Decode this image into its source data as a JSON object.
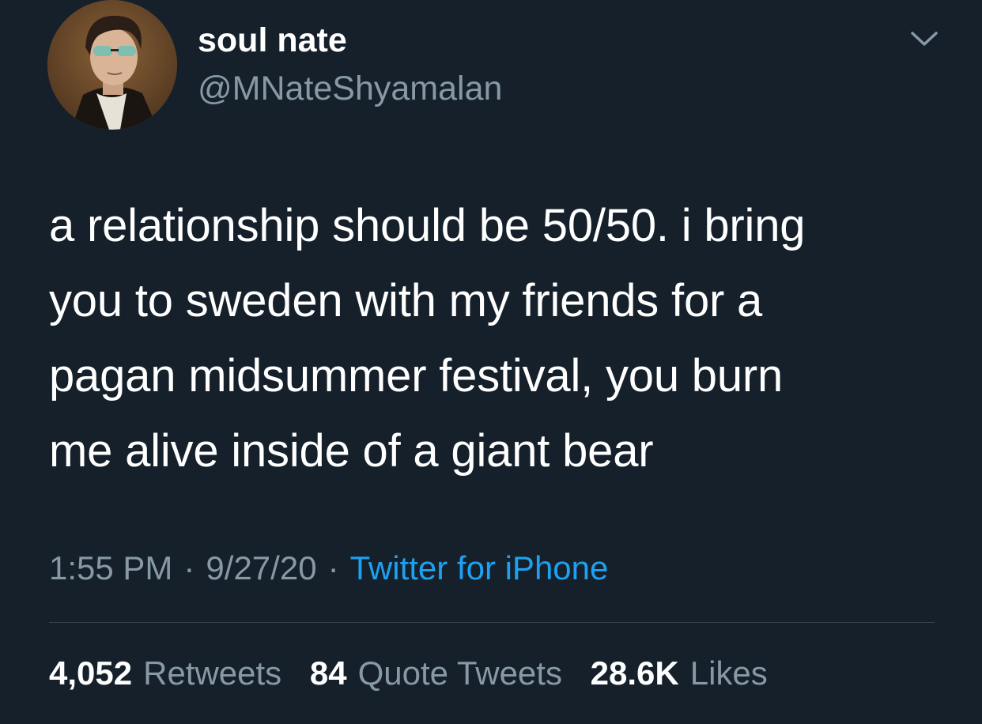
{
  "tweet": {
    "author": {
      "display_name": "soul nate",
      "handle": "@MNateShyamalan"
    },
    "text": "a relationship should be 50/50. i bring\nyou to sweden with my friends for a\npagan midsummer festival, you burn\nme alive inside of a giant bear",
    "meta": {
      "time": "1:55 PM",
      "separator": "·",
      "date": "9/27/20",
      "source": "Twitter for iPhone"
    },
    "stats": {
      "retweets_count": "4,052",
      "retweets_label": "Retweets",
      "quotes_count": "84",
      "quotes_label": "Quote Tweets",
      "likes_count": "28.6K",
      "likes_label": "Likes"
    }
  },
  "icons": {
    "menu": "chevron-down-icon",
    "avatar": "avatar-portrait"
  },
  "colors": {
    "background": "#15202b",
    "primary_text": "#ffffff",
    "secondary_text": "#8899a6",
    "link": "#1da1f2",
    "divider": "#38444d"
  }
}
